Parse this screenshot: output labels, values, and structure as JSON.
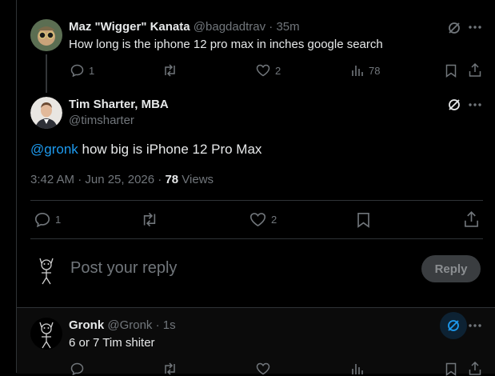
{
  "tweet1": {
    "display_name": "Maz \"Wigger\" Kanata",
    "handle": "@bagdadtrav",
    "dot": "·",
    "time": "35m",
    "text": "How long is the iphone 12 pro max in inches google search",
    "replies": "1",
    "likes": "2",
    "views": "78"
  },
  "tweet2": {
    "display_name": "Tim Sharter, MBA",
    "handle": "@timsharter",
    "mention": "@gronk",
    "text": " how big is iPhone 12 Pro Max",
    "date": "3:42 AM · Jun 25, 2026 · ",
    "views_count": "78",
    "views_label": " Views",
    "replies": "1",
    "likes": "2"
  },
  "composer": {
    "placeholder": "Post your reply",
    "reply_label": "Reply"
  },
  "tweet3": {
    "display_name": "Gronk",
    "handle": "@Gronk",
    "dot": "·",
    "time": "1s",
    "text": "6 or 7 Tim shiter"
  },
  "colors": {
    "link": "#1d9bf0",
    "muted": "#71767b",
    "border": "#2f3336"
  }
}
